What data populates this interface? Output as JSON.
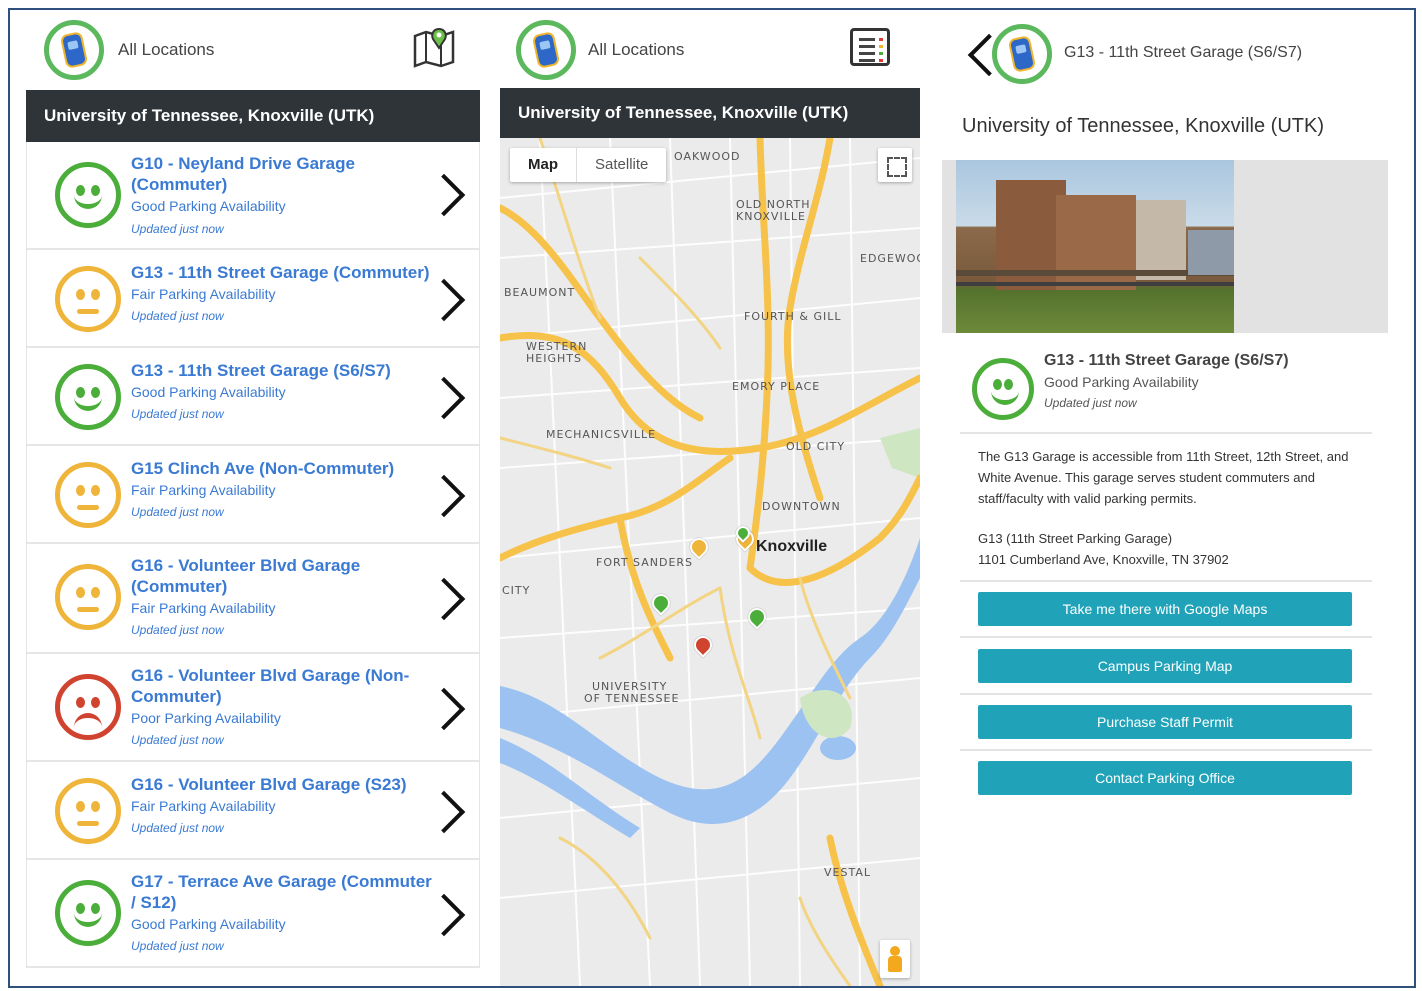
{
  "panel1": {
    "title": "All Locations",
    "header": "University of Tennessee, Knoxville (UTK)",
    "items": [
      {
        "name": "G10 - Neyland Drive Garage (Commuter)",
        "status": "Good Parking Availability",
        "updated": "Updated just now",
        "level": "good"
      },
      {
        "name": "G13 - 11th Street Garage (Commuter)",
        "status": "Fair Parking Availability",
        "updated": "Updated just now",
        "level": "fair"
      },
      {
        "name": "G13 - 11th Street Garage (S6/S7)",
        "status": "Good Parking Availability",
        "updated": "Updated just now",
        "level": "good"
      },
      {
        "name": "G15 Clinch Ave (Non-Commuter)",
        "status": "Fair Parking Availability",
        "updated": "Updated just now",
        "level": "fair"
      },
      {
        "name": "G16 - Volunteer Blvd Garage (Commuter)",
        "status": "Fair Parking Availability",
        "updated": "Updated just now",
        "level": "fair"
      },
      {
        "name": "G16 - Volunteer Blvd Garage (Non-Commuter)",
        "status": "Poor Parking Availability",
        "updated": "Updated just now",
        "level": "poor"
      },
      {
        "name": "G16 - Volunteer Blvd Garage (S23)",
        "status": "Fair Parking Availability",
        "updated": "Updated just now",
        "level": "fair"
      },
      {
        "name": "G17 - Terrace Ave Garage (Commuter / S12)",
        "status": "Good Parking Availability",
        "updated": "Updated just now",
        "level": "good"
      }
    ]
  },
  "panel2": {
    "title": "All Locations",
    "header": "University of Tennessee, Knoxville (UTK)",
    "map_toggle": {
      "map": "Map",
      "satellite": "Satellite"
    },
    "labels": {
      "oakwood": "OAKWOOD",
      "old_north": "OLD NORTH",
      "knoxville_sub": "KNOXVILLE",
      "edgewood": "EDGEWOOD",
      "beaumont": "BEAUMONT",
      "fourth_gill": "FOURTH & GILL",
      "western": "WESTERN",
      "heights": "HEIGHTS",
      "emory": "EMORY PLACE",
      "mechanicsville": "MECHANICSVILLE",
      "old_city": "OLD CITY",
      "downtown": "DOWNTOWN",
      "fort_sanders": "FORT SANDERS",
      "city": "CITY",
      "university": "UNIVERSITY",
      "of_tennessee": "OF TENNESSEE",
      "vestal": "VESTAL"
    },
    "city_label": "Knoxville"
  },
  "panel3": {
    "title": "G13 - 11th Street Garage (S6/S7)",
    "university": "University of Tennessee, Knoxville (UTK)",
    "garage_name": "G13 - 11th Street Garage (S6/S7)",
    "status": "Good Parking Availability",
    "updated": "Updated just now",
    "description": "The G13 Garage is accessible from 11th Street, 12th Street, and White Avenue. This garage serves student commuters and staff/faculty with valid parking permits.",
    "address_line1": "G13 (11th Street Parking Garage)",
    "address_line2": "1101 Cumberland Ave, Knoxville, TN 37902",
    "buttons": {
      "google_maps": "Take me there with Google Maps",
      "campus_map": "Campus Parking Map",
      "staff_permit": "Purchase Staff Permit",
      "contact": "Contact Parking Office"
    }
  },
  "colors": {
    "good": "#4cae3a",
    "fair": "#efb43a",
    "poor": "#d0432f",
    "link": "#3a7ad3",
    "header_band": "#2f3438",
    "button": "#20a3b9"
  }
}
